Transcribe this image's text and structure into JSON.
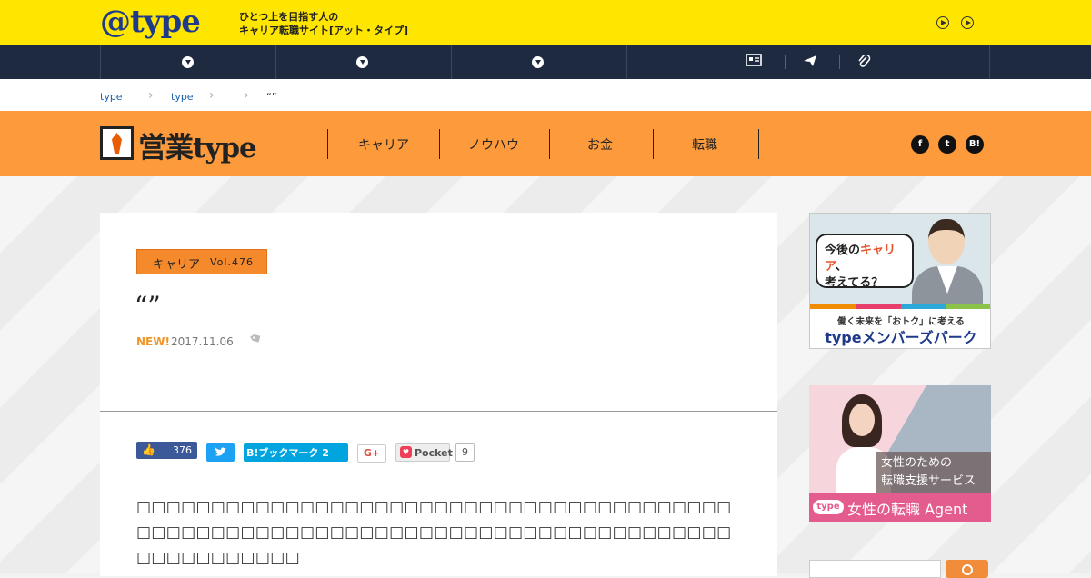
{
  "topbar": {
    "logo": "@type",
    "tagline_line1": "ひとつ上を目指す人の",
    "tagline_line2": "キャリア転職サイト[アット・タイプ]"
  },
  "darknav": {
    "icons": [
      "id-card-icon",
      "paper-plane-icon",
      "paperclip-icon"
    ]
  },
  "breadcrumb": [
    "type",
    "type",
    "“”"
  ],
  "site_header": {
    "logo_text": "営業type",
    "menu": [
      "キャリア",
      "ノウハウ",
      "お金",
      "転職"
    ],
    "social": [
      "f",
      "t",
      "B!"
    ]
  },
  "article": {
    "category": "キャリア",
    "vol": "Vol.476",
    "title": "“”",
    "new_label": "NEW!",
    "date": "2017.11.06",
    "share": {
      "facebook_count": "376",
      "hatena_label": "B!ブックマーク 2",
      "gplus_label": "G+",
      "pocket_label": "Pocket",
      "pocket_count": "9"
    },
    "body": "□□□□□□□□□□□□□□□□□□□□□□□□□□□□□□□□□□□□□□□□□□□□□□□□□□□□□□□□□□□□□□□□□□□□□□□□□□□□□□□□□□□□□□□□□□□"
  },
  "sidebar": {
    "banner1": {
      "bubble_line1_a": "今後の",
      "bubble_line1_b": "キャリア",
      "bubble_line1_c": "、",
      "bubble_line2": "考えてる？",
      "caption1": "働く未来を「おトク」に考える",
      "caption2": "typeメンバーズパーク"
    },
    "banner2": {
      "line1": "女性のための",
      "line2": "転職支援サービス",
      "pill": "type",
      "agent": "女性の転職 Agent"
    }
  },
  "colors": {
    "topbar": "#ffe600",
    "darknav": "#1e2a3f",
    "orange_header": "#fd9a3c",
    "accent": "#f58a2d"
  }
}
